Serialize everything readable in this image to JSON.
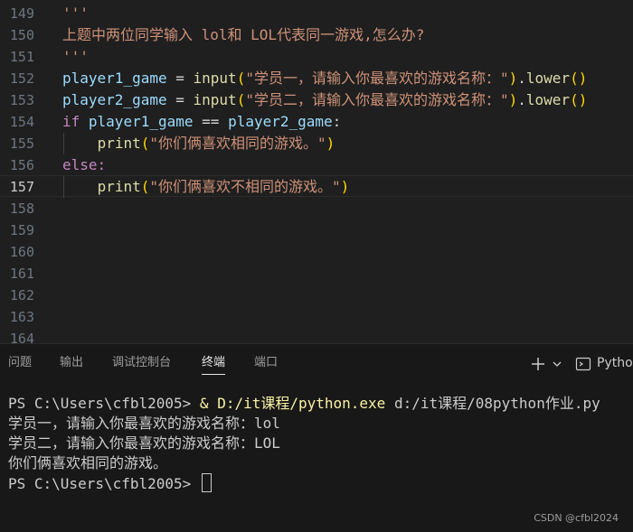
{
  "editor": {
    "lines": [
      {
        "n": "149",
        "code": "'''"
      },
      {
        "n": "150",
        "code": "上题中两位同学输入 lol和 LOL代表同一游戏,怎么办?"
      },
      {
        "n": "151",
        "code": "'''"
      },
      {
        "n": "152",
        "code": "player1_game = input(\"学员一，请输入你最喜欢的游戏名称：\").lower()"
      },
      {
        "n": "153",
        "code": "player2_game = input(\"学员二，请输入你最喜欢的游戏名称：\").lower()"
      },
      {
        "n": "154",
        "code": "if player1_game == player2_game:"
      },
      {
        "n": "155",
        "code": "    print(\"你们俩喜欢相同的游戏。\")"
      },
      {
        "n": "156",
        "code": "else:"
      },
      {
        "n": "157",
        "code": "    print(\"你们俩喜欢不相同的游戏。\")"
      },
      {
        "n": "158",
        "code": ""
      },
      {
        "n": "159",
        "code": ""
      },
      {
        "n": "160",
        "code": ""
      },
      {
        "n": "161",
        "code": ""
      },
      {
        "n": "162",
        "code": ""
      },
      {
        "n": "163",
        "code": ""
      },
      {
        "n": "164",
        "code": ""
      }
    ],
    "active_line": "157"
  },
  "panel": {
    "tabs": [
      {
        "label": "问题",
        "active": false
      },
      {
        "label": "输出",
        "active": false
      },
      {
        "label": "调试控制台",
        "active": false
      },
      {
        "label": "终端",
        "active": true
      },
      {
        "label": "端口",
        "active": false
      }
    ],
    "add_icon": "plus-icon",
    "dropdown_icon": "chevron-down-icon",
    "terminal_profile_label": "Python"
  },
  "terminal": {
    "prompt1": "PS C:\\Users\\cfbl2005> ",
    "cmd_amp": "& ",
    "cmd_exe": "D:/it课程/python.exe",
    "cmd_arg": " d:/it课程/08python作业.py",
    "out1": "学员一，请输入你最喜欢的游戏名称：lol",
    "out2": "学员二，请输入你最喜欢的游戏名称：LOL",
    "out3": "你们俩喜欢相同的游戏。",
    "prompt2": "PS C:\\Users\\cfbl2005> "
  },
  "watermark": "CSDN @cfbl2024"
}
